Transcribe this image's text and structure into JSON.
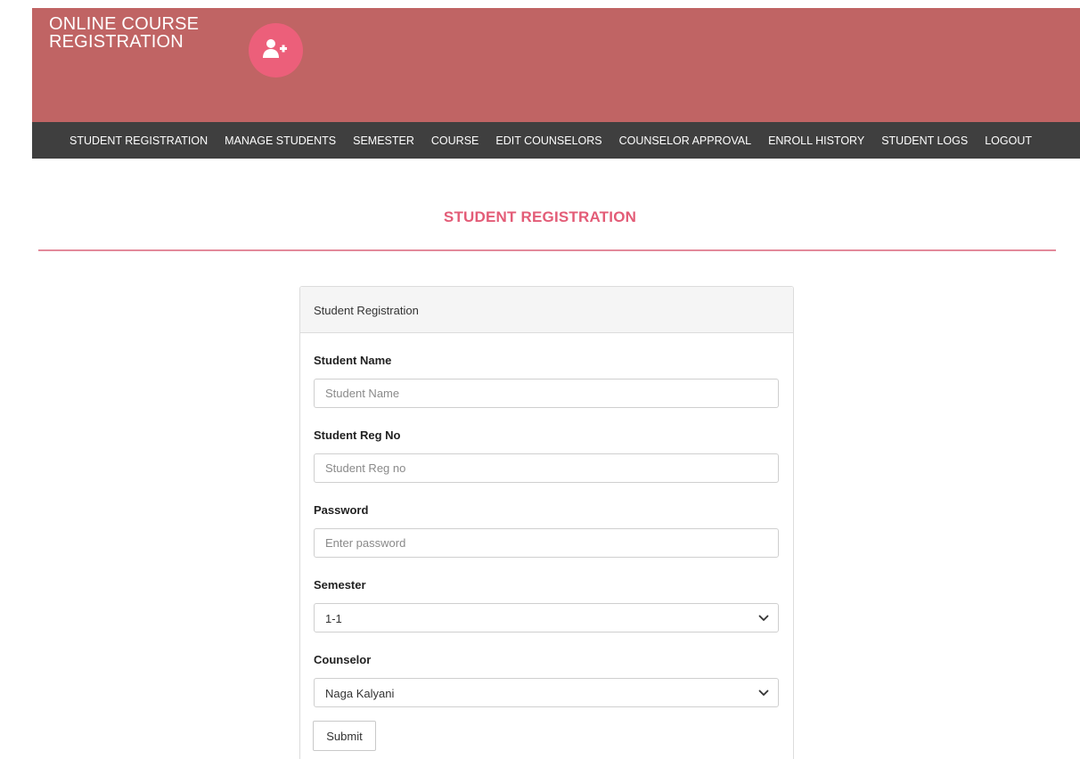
{
  "app": {
    "brand_line1": "ONLINE COURSE",
    "brand_line2": "REGISTRATION",
    "logo_icon": "user-plus-icon",
    "colors": {
      "header_bg": "#c06464",
      "logo_bg": "#ec5f7a",
      "nav_bg": "#3f3f3f",
      "accent": "#e35c77"
    }
  },
  "nav": {
    "items": [
      {
        "label": "STUDENT REGISTRATION"
      },
      {
        "label": "MANAGE STUDENTS"
      },
      {
        "label": "SEMESTER"
      },
      {
        "label": "COURSE"
      },
      {
        "label": "EDIT COUNSELORS"
      },
      {
        "label": "COUNSELOR APPROVAL"
      },
      {
        "label": "ENROLL HISTORY"
      },
      {
        "label": "STUDENT LOGS"
      },
      {
        "label": "LOGOUT"
      }
    ]
  },
  "page": {
    "title": "STUDENT REGISTRATION"
  },
  "form": {
    "panel_title": "Student Registration",
    "student_name": {
      "label": "Student Name",
      "placeholder": "Student Name",
      "value": ""
    },
    "reg_no": {
      "label": "Student Reg No",
      "placeholder": "Student Reg no",
      "value": ""
    },
    "password": {
      "label": "Password",
      "placeholder": "Enter password",
      "value": ""
    },
    "semester": {
      "label": "Semester",
      "selected": "1-1",
      "icon": "chevron-down-icon"
    },
    "counselor": {
      "label": "Counselor",
      "selected": "Naga Kalyani",
      "icon": "chevron-down-icon"
    },
    "submit_label": "Submit"
  }
}
